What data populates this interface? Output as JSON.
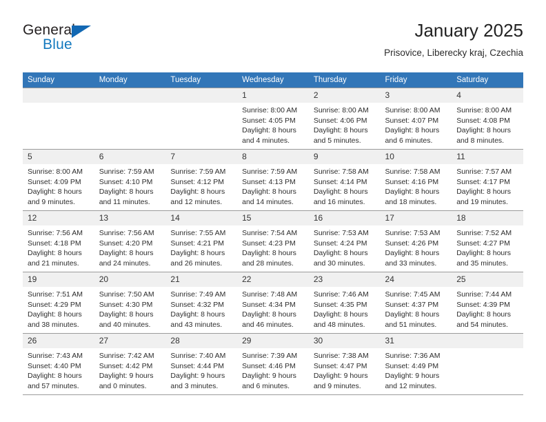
{
  "brand": {
    "name_part1": "General",
    "name_part2": "Blue",
    "triangle_color": "#1268b3",
    "blue_color": "#1278be"
  },
  "header": {
    "title": "January 2025",
    "subtitle": "Prisovice, Liberecky kraj, Czechia"
  },
  "calendar": {
    "header_bg": "#3276b8",
    "daynum_bg": "#f0f0f0",
    "weekday_headers": [
      "Sunday",
      "Monday",
      "Tuesday",
      "Wednesday",
      "Thursday",
      "Friday",
      "Saturday"
    ],
    "weeks": [
      [
        {
          "day": "",
          "empty": true
        },
        {
          "day": "",
          "empty": true
        },
        {
          "day": "",
          "empty": true
        },
        {
          "day": "1",
          "sunrise": "Sunrise: 8:00 AM",
          "sunset": "Sunset: 4:05 PM",
          "daylight1": "Daylight: 8 hours",
          "daylight2": "and 4 minutes."
        },
        {
          "day": "2",
          "sunrise": "Sunrise: 8:00 AM",
          "sunset": "Sunset: 4:06 PM",
          "daylight1": "Daylight: 8 hours",
          "daylight2": "and 5 minutes."
        },
        {
          "day": "3",
          "sunrise": "Sunrise: 8:00 AM",
          "sunset": "Sunset: 4:07 PM",
          "daylight1": "Daylight: 8 hours",
          "daylight2": "and 6 minutes."
        },
        {
          "day": "4",
          "sunrise": "Sunrise: 8:00 AM",
          "sunset": "Sunset: 4:08 PM",
          "daylight1": "Daylight: 8 hours",
          "daylight2": "and 8 minutes."
        }
      ],
      [
        {
          "day": "5",
          "sunrise": "Sunrise: 8:00 AM",
          "sunset": "Sunset: 4:09 PM",
          "daylight1": "Daylight: 8 hours",
          "daylight2": "and 9 minutes."
        },
        {
          "day": "6",
          "sunrise": "Sunrise: 7:59 AM",
          "sunset": "Sunset: 4:10 PM",
          "daylight1": "Daylight: 8 hours",
          "daylight2": "and 11 minutes."
        },
        {
          "day": "7",
          "sunrise": "Sunrise: 7:59 AM",
          "sunset": "Sunset: 4:12 PM",
          "daylight1": "Daylight: 8 hours",
          "daylight2": "and 12 minutes."
        },
        {
          "day": "8",
          "sunrise": "Sunrise: 7:59 AM",
          "sunset": "Sunset: 4:13 PM",
          "daylight1": "Daylight: 8 hours",
          "daylight2": "and 14 minutes."
        },
        {
          "day": "9",
          "sunrise": "Sunrise: 7:58 AM",
          "sunset": "Sunset: 4:14 PM",
          "daylight1": "Daylight: 8 hours",
          "daylight2": "and 16 minutes."
        },
        {
          "day": "10",
          "sunrise": "Sunrise: 7:58 AM",
          "sunset": "Sunset: 4:16 PM",
          "daylight1": "Daylight: 8 hours",
          "daylight2": "and 18 minutes."
        },
        {
          "day": "11",
          "sunrise": "Sunrise: 7:57 AM",
          "sunset": "Sunset: 4:17 PM",
          "daylight1": "Daylight: 8 hours",
          "daylight2": "and 19 minutes."
        }
      ],
      [
        {
          "day": "12",
          "sunrise": "Sunrise: 7:56 AM",
          "sunset": "Sunset: 4:18 PM",
          "daylight1": "Daylight: 8 hours",
          "daylight2": "and 21 minutes."
        },
        {
          "day": "13",
          "sunrise": "Sunrise: 7:56 AM",
          "sunset": "Sunset: 4:20 PM",
          "daylight1": "Daylight: 8 hours",
          "daylight2": "and 24 minutes."
        },
        {
          "day": "14",
          "sunrise": "Sunrise: 7:55 AM",
          "sunset": "Sunset: 4:21 PM",
          "daylight1": "Daylight: 8 hours",
          "daylight2": "and 26 minutes."
        },
        {
          "day": "15",
          "sunrise": "Sunrise: 7:54 AM",
          "sunset": "Sunset: 4:23 PM",
          "daylight1": "Daylight: 8 hours",
          "daylight2": "and 28 minutes."
        },
        {
          "day": "16",
          "sunrise": "Sunrise: 7:53 AM",
          "sunset": "Sunset: 4:24 PM",
          "daylight1": "Daylight: 8 hours",
          "daylight2": "and 30 minutes."
        },
        {
          "day": "17",
          "sunrise": "Sunrise: 7:53 AM",
          "sunset": "Sunset: 4:26 PM",
          "daylight1": "Daylight: 8 hours",
          "daylight2": "and 33 minutes."
        },
        {
          "day": "18",
          "sunrise": "Sunrise: 7:52 AM",
          "sunset": "Sunset: 4:27 PM",
          "daylight1": "Daylight: 8 hours",
          "daylight2": "and 35 minutes."
        }
      ],
      [
        {
          "day": "19",
          "sunrise": "Sunrise: 7:51 AM",
          "sunset": "Sunset: 4:29 PM",
          "daylight1": "Daylight: 8 hours",
          "daylight2": "and 38 minutes."
        },
        {
          "day": "20",
          "sunrise": "Sunrise: 7:50 AM",
          "sunset": "Sunset: 4:30 PM",
          "daylight1": "Daylight: 8 hours",
          "daylight2": "and 40 minutes."
        },
        {
          "day": "21",
          "sunrise": "Sunrise: 7:49 AM",
          "sunset": "Sunset: 4:32 PM",
          "daylight1": "Daylight: 8 hours",
          "daylight2": "and 43 minutes."
        },
        {
          "day": "22",
          "sunrise": "Sunrise: 7:48 AM",
          "sunset": "Sunset: 4:34 PM",
          "daylight1": "Daylight: 8 hours",
          "daylight2": "and 46 minutes."
        },
        {
          "day": "23",
          "sunrise": "Sunrise: 7:46 AM",
          "sunset": "Sunset: 4:35 PM",
          "daylight1": "Daylight: 8 hours",
          "daylight2": "and 48 minutes."
        },
        {
          "day": "24",
          "sunrise": "Sunrise: 7:45 AM",
          "sunset": "Sunset: 4:37 PM",
          "daylight1": "Daylight: 8 hours",
          "daylight2": "and 51 minutes."
        },
        {
          "day": "25",
          "sunrise": "Sunrise: 7:44 AM",
          "sunset": "Sunset: 4:39 PM",
          "daylight1": "Daylight: 8 hours",
          "daylight2": "and 54 minutes."
        }
      ],
      [
        {
          "day": "26",
          "sunrise": "Sunrise: 7:43 AM",
          "sunset": "Sunset: 4:40 PM",
          "daylight1": "Daylight: 8 hours",
          "daylight2": "and 57 minutes."
        },
        {
          "day": "27",
          "sunrise": "Sunrise: 7:42 AM",
          "sunset": "Sunset: 4:42 PM",
          "daylight1": "Daylight: 9 hours",
          "daylight2": "and 0 minutes."
        },
        {
          "day": "28",
          "sunrise": "Sunrise: 7:40 AM",
          "sunset": "Sunset: 4:44 PM",
          "daylight1": "Daylight: 9 hours",
          "daylight2": "and 3 minutes."
        },
        {
          "day": "29",
          "sunrise": "Sunrise: 7:39 AM",
          "sunset": "Sunset: 4:46 PM",
          "daylight1": "Daylight: 9 hours",
          "daylight2": "and 6 minutes."
        },
        {
          "day": "30",
          "sunrise": "Sunrise: 7:38 AM",
          "sunset": "Sunset: 4:47 PM",
          "daylight1": "Daylight: 9 hours",
          "daylight2": "and 9 minutes."
        },
        {
          "day": "31",
          "sunrise": "Sunrise: 7:36 AM",
          "sunset": "Sunset: 4:49 PM",
          "daylight1": "Daylight: 9 hours",
          "daylight2": "and 12 minutes."
        },
        {
          "day": "",
          "empty": true
        }
      ]
    ]
  }
}
